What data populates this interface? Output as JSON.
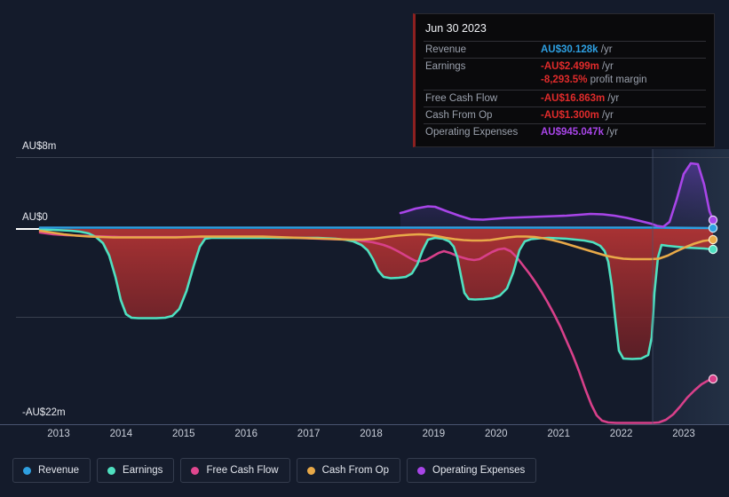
{
  "axes": {
    "y_top_label": "AU$8m",
    "y_zero_label": "AU$0",
    "y_bottom_label": "-AU$22m",
    "x_ticks": [
      "2013",
      "2014",
      "2015",
      "2016",
      "2017",
      "2018",
      "2019",
      "2020",
      "2021",
      "2022",
      "2023"
    ]
  },
  "tooltip": {
    "date": "Jun 30 2023",
    "rows": [
      {
        "label": "Revenue",
        "value": "AU$30.128k",
        "unit": "/yr",
        "color": "#2e9fe0"
      },
      {
        "label": "Earnings",
        "value": "-AU$2.499m",
        "unit": "/yr",
        "color": "#e02b2b"
      },
      {
        "label": "",
        "value": "-8,293.5%",
        "unit": "profit margin",
        "color": "#e02b2b"
      },
      {
        "label": "Free Cash Flow",
        "value": "-AU$16.863m",
        "unit": "/yr",
        "color": "#e02b2b"
      },
      {
        "label": "Cash From Op",
        "value": "-AU$1.300m",
        "unit": "/yr",
        "color": "#e02b2b"
      },
      {
        "label": "Operating Expenses",
        "value": "AU$945.047k",
        "unit": "/yr",
        "color": "#a845e8"
      }
    ]
  },
  "legend": [
    {
      "label": "Revenue",
      "color": "#2e9fe0"
    },
    {
      "label": "Earnings",
      "color": "#4fe0c0"
    },
    {
      "label": "Free Cash Flow",
      "color": "#e0478f"
    },
    {
      "label": "Cash From Op",
      "color": "#e8a948"
    },
    {
      "label": "Operating Expenses",
      "color": "#a845e8"
    }
  ],
  "chart_data": {
    "type": "line",
    "title": "",
    "xlabel": "",
    "ylabel": "AU$",
    "ylim": [
      -22,
      8
    ],
    "y_ticks": [
      8,
      0,
      -9,
      -22
    ],
    "grid": true,
    "legend_position": "bottom",
    "currency": "AUD",
    "x": [
      "2012.6",
      "2013",
      "2013.5",
      "2014",
      "2014.5",
      "2015",
      "2015.5",
      "2016",
      "2016.5",
      "2017",
      "2017.5",
      "2018",
      "2018.5",
      "2019",
      "2019.5",
      "2020",
      "2020.5",
      "2021",
      "2021.5",
      "2022",
      "2022.5",
      "2023",
      "2023.4"
    ],
    "forecast_start": "2022.5",
    "series": [
      {
        "name": "Revenue",
        "color": "#2e9fe0",
        "values": [
          0.05,
          0.05,
          0.05,
          0.05,
          0.05,
          0.05,
          0.05,
          0.05,
          0.05,
          0.05,
          0.05,
          0.05,
          0.05,
          0.05,
          0.05,
          0.05,
          0.05,
          0.05,
          0.05,
          0.05,
          0.05,
          0.03,
          0.03
        ]
      },
      {
        "name": "Earnings",
        "color": "#4fe0c0",
        "values": [
          -0.3,
          -0.8,
          -9.0,
          -9.0,
          -6.2,
          -0.5,
          -0.5,
          -0.5,
          -0.6,
          -0.7,
          -0.9,
          -1.5,
          -3.0,
          -3.2,
          -2.9,
          -0.6,
          -0.7,
          -1.0,
          -8.0,
          -8.2,
          -8.1,
          -1.1,
          -2.5
        ]
      },
      {
        "name": "Free Cash Flow",
        "color": "#e0478f",
        "values": [
          -0.4,
          -0.5,
          -0.5,
          -0.5,
          -0.5,
          -0.5,
          -0.5,
          -0.5,
          -0.6,
          -0.8,
          -1.6,
          -2.5,
          -2.1,
          -1.4,
          -1.4,
          -2.0,
          -3.5,
          -6.5,
          -14.0,
          -21.5,
          -21.5,
          -17.5,
          -16.9
        ]
      },
      {
        "name": "Cash From Op",
        "color": "#e8a948",
        "values": [
          -0.35,
          -0.45,
          -0.5,
          -0.5,
          -0.5,
          -0.45,
          -0.45,
          -0.5,
          -0.55,
          -0.5,
          -0.45,
          -0.5,
          -0.35,
          -0.5,
          -0.7,
          -0.8,
          -0.6,
          -0.55,
          -0.8,
          -1.1,
          -1.1,
          -0.6,
          -1.3
        ]
      },
      {
        "name": "Operating Expenses",
        "color": "#a845e8",
        "values": [
          null,
          null,
          null,
          null,
          null,
          null,
          null,
          null,
          null,
          null,
          null,
          0.55,
          0.9,
          0.75,
          0.45,
          0.4,
          0.45,
          0.5,
          0.7,
          0.55,
          0.1,
          7.3,
          0.95
        ]
      }
    ]
  }
}
